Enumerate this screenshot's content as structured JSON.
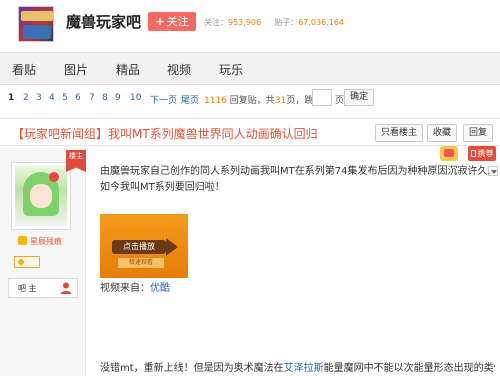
{
  "header": {
    "bar_title": "魔兽玩家吧",
    "follow_label": "关注",
    "follow_stat_label": "关注：",
    "follow_count": "953,906",
    "post_stat_label": "贴子：",
    "post_count": "67,036,164"
  },
  "nav": {
    "items": [
      {
        "label": "看贴"
      },
      {
        "label": "图片"
      },
      {
        "label": "精品"
      },
      {
        "label": "视频"
      },
      {
        "label": "玩乐"
      }
    ]
  },
  "pager": {
    "pages": [
      "1",
      "2",
      "3",
      "4",
      "5",
      "6",
      "7",
      "8",
      "9",
      "10"
    ],
    "current": "1",
    "next_label": "下一页",
    "last_label": "尾页",
    "reply_count": "1116",
    "reply_suffix": " 回复贴，共",
    "page_total": "31",
    "page_suffix": "页，跳到",
    "page_unit": "页",
    "confirm_label": "确定"
  },
  "post": {
    "title": "【玩家吧新闻组】我叫MT系列魔兽世界同人动画确认回归",
    "only_author_label": "只看楼主",
    "favorite_label": "收藏",
    "reply_label": "回复"
  },
  "badges": {
    "mobile_label": "携尊"
  },
  "user": {
    "floor_label": "楼主",
    "nickname": "星辰残痕",
    "role_label": "吧 主"
  },
  "content": {
    "paragraph1": "由魔兽玩家自己创作的同人系列动画我叫MT在系列第74集发布后因为种种原因沉寂许久...",
    "paragraph2": "如今我叫MT系列要回归啦！",
    "video_banner": "点击播放",
    "video_sub": "极速观看",
    "video_source_label": "视频来自：",
    "video_source_link": "优酷",
    "paragraph3_a": "没错mt，重新上线！但是因为奥术魔法在",
    "paragraph3_link": "艾泽拉斯",
    "paragraph3_b": "能量魔网中不能以次能量形态出现的类似"
  }
}
